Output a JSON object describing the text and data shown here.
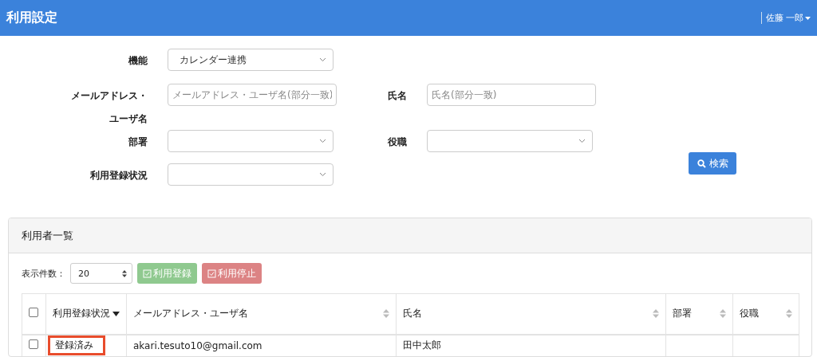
{
  "header": {
    "title": "利用設定",
    "user": "佐藤 一郎"
  },
  "filters": {
    "function": {
      "label": "機能",
      "value": "カレンダー連携"
    },
    "email": {
      "label_lines": [
        "メールアドレス・",
        "ユーザ名"
      ],
      "placeholder": "メールアドレス・ユーザ名(部分一致)"
    },
    "name": {
      "label": "氏名",
      "placeholder": "氏名(部分一致)"
    },
    "department": {
      "label": "部署"
    },
    "position": {
      "label": "役職"
    },
    "status": {
      "label": "利用登録状況"
    },
    "search_button": "検索"
  },
  "panel": {
    "title": "利用者一覧",
    "page_size_label": "表示件数：",
    "page_size": "20",
    "actions": [
      {
        "label": "利用登録",
        "kind": "register"
      },
      {
        "label": "利用停止",
        "kind": "stop"
      }
    ],
    "table": {
      "select_all": false,
      "columns": [
        {
          "label": "利用登録状況",
          "sorted": true
        },
        {
          "label": "メールアドレス・ユーザ名",
          "sorted": false
        },
        {
          "label": "氏名",
          "sorted": false
        },
        {
          "label": "部署",
          "sorted": false
        },
        {
          "label": "役職",
          "sorted": false
        }
      ],
      "rows": [
        {
          "checked": false,
          "status": "登録済み",
          "highlighted": true,
          "email": "akari.tesuto10@gmail.com",
          "name": "田中太郎"
        }
      ]
    }
  }
}
